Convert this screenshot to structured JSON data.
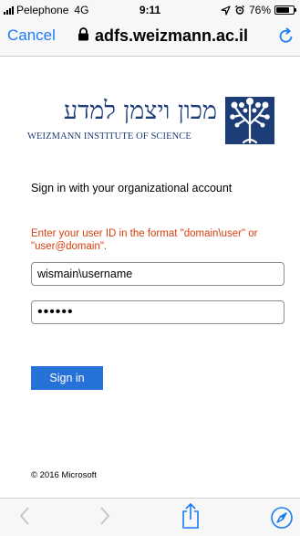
{
  "status_bar": {
    "carrier": "Pelephone",
    "network": "4G",
    "time": "9:11",
    "battery_percent": "76%",
    "battery_level": 0.76
  },
  "nav": {
    "cancel_label": "Cancel",
    "url": "adfs.weizmann.ac.il",
    "accent_color": "#1a7cf5"
  },
  "logo": {
    "hebrew_text": "מכון ויצמן למדע",
    "english_text": "WEIZMANN INSTITUTE OF SCIENCE",
    "color": "#1d3d77"
  },
  "form": {
    "heading": "Sign in with your organizational account",
    "error_message": "Enter your user ID in the format \"domain\\user\" or \"user@domain\".",
    "error_color": "#d6400c",
    "username_value": "wismain\\username",
    "password_value": "••••••",
    "signin_label": "Sign in",
    "button_color": "#2672d9"
  },
  "footer": {
    "copyright": "© 2016 Microsoft"
  },
  "toolbar": {
    "icons": [
      "back-icon",
      "forward-icon",
      "share-icon",
      "safari-icon"
    ]
  }
}
